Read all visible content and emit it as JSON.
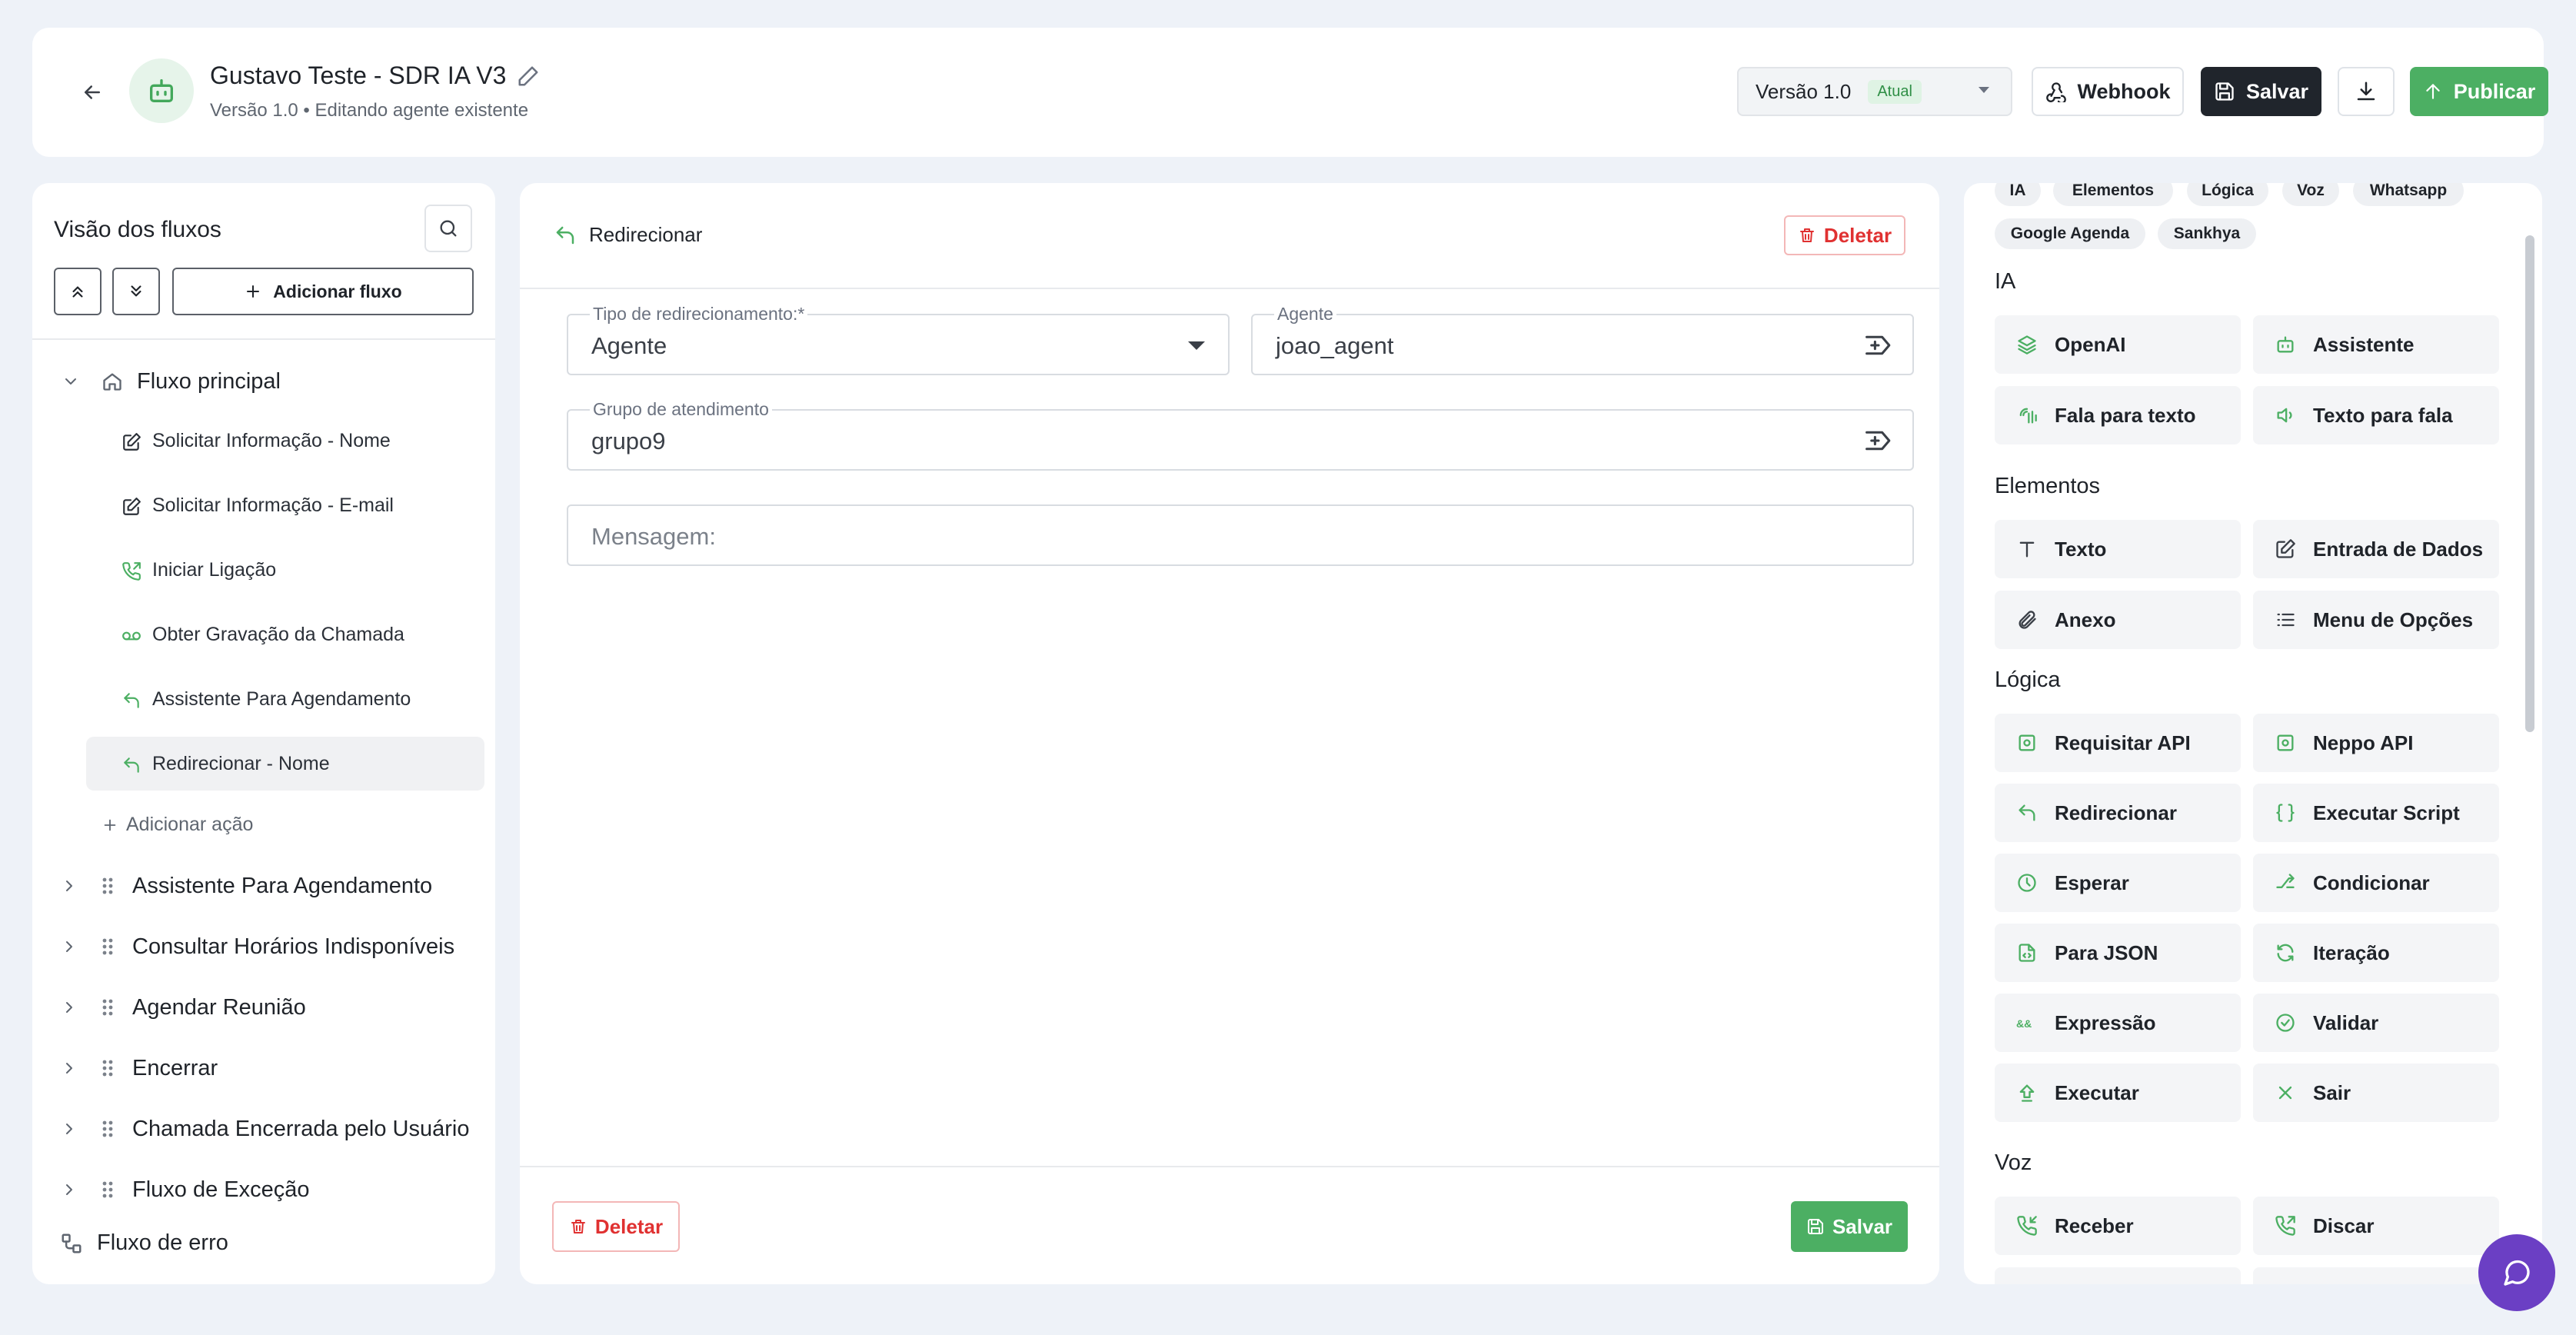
{
  "header": {
    "title": "Gustavo Teste - SDR IA V3",
    "subtitle": "Versão 1.0 • Editando agente existente",
    "version_select": "Versão 1.0",
    "version_badge": "Atual",
    "webhook_label": "Webhook",
    "save_label": "Salvar",
    "publish_label": "Publicar"
  },
  "sidebar": {
    "title": "Visão dos fluxos",
    "add_flow_label": "Adicionar fluxo",
    "main_flow": {
      "label": "Fluxo principal",
      "items": [
        {
          "label": "Solicitar Informação - Nome",
          "icon": "edit-icon"
        },
        {
          "label": "Solicitar Informação - E-mail",
          "icon": "edit-icon"
        },
        {
          "label": "Iniciar Ligação",
          "icon": "phone-outgoing-icon"
        },
        {
          "label": "Obter Gravação da Chamada",
          "icon": "voicemail-icon"
        },
        {
          "label": "Assistente Para Agendamento",
          "icon": "redirect-icon"
        },
        {
          "label": "Redirecionar - Nome",
          "icon": "redirect-icon"
        }
      ],
      "add_action_label": "Adicionar ação"
    },
    "flows": [
      {
        "label": "Assistente Para Agendamento"
      },
      {
        "label": "Consultar Horários Indisponíveis"
      },
      {
        "label": "Agendar Reunião"
      },
      {
        "label": "Encerrar"
      },
      {
        "label": "Chamada Encerrada pelo Usuário"
      },
      {
        "label": "Fluxo de Exceção"
      }
    ],
    "error_flow_label": "Fluxo de erro"
  },
  "editor": {
    "node_type": "Redirecionar",
    "delete_label": "Deletar",
    "save_label": "Salvar",
    "redirect_type": {
      "label": "Tipo de redirecionamento:*",
      "value": "Agente"
    },
    "agent": {
      "label": "Agente",
      "value": "joao_agent"
    },
    "group": {
      "label": "Grupo de atendimento",
      "value": "grupo9"
    },
    "message": {
      "placeholder": "Mensagem:"
    }
  },
  "palette": {
    "chips": [
      "IA",
      "Elementos",
      "Lógica",
      "Voz",
      "Whatsapp",
      "Google Agenda",
      "Sankhya"
    ],
    "sections": [
      {
        "title": "IA",
        "items": [
          "OpenAI",
          "Assistente",
          "Fala para texto",
          "Texto para fala"
        ]
      },
      {
        "title": "Elementos",
        "items": [
          "Texto",
          "Entrada de Dados",
          "Anexo",
          "Menu de Opções"
        ]
      },
      {
        "title": "Lógica",
        "items": [
          "Requisitar API",
          "Neppo API",
          "Redirecionar",
          "Executar Script",
          "Esperar",
          "Condicionar",
          "Para JSON",
          "Iteração",
          "Expressão",
          "Validar",
          "Executar",
          "Sair"
        ]
      },
      {
        "title": "Voz",
        "items": [
          "Receber",
          "Discar"
        ]
      }
    ]
  },
  "colors": {
    "accent": "#4caf63",
    "danger": "#e03131",
    "dark_button": "#20252c",
    "chat_fab": "#6b3fc4",
    "background": "#eef2f8"
  }
}
